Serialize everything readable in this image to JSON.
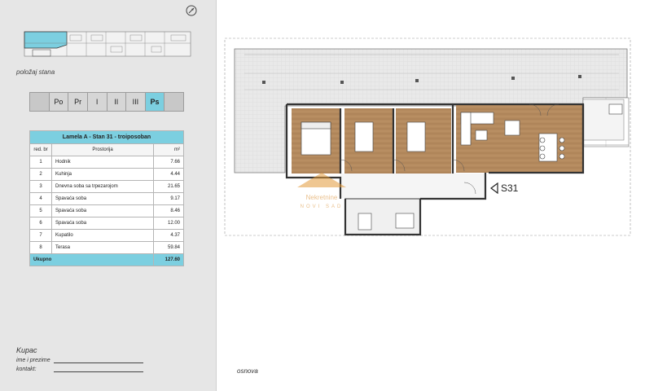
{
  "sidebar": {
    "position_label": "položaj stana",
    "floor_tabs": [
      {
        "label": "Po",
        "active": false
      },
      {
        "label": "Pr",
        "active": false
      },
      {
        "label": "I",
        "active": false
      },
      {
        "label": "II",
        "active": false
      },
      {
        "label": "III",
        "active": false
      },
      {
        "label": "Ps",
        "active": true
      }
    ],
    "table": {
      "title": "Lamela A - Stan 31 - troiposoban",
      "headers": {
        "number": "red. br",
        "room": "Prostorija",
        "area": "m²"
      },
      "rows": [
        {
          "nr": "1",
          "name": "Hodnik",
          "area": "7.66"
        },
        {
          "nr": "2",
          "name": "Kuhinja",
          "area": "4.44"
        },
        {
          "nr": "3",
          "name": "Dnevna soba sa trpezarojom",
          "area": "21.65"
        },
        {
          "nr": "4",
          "name": "Spavaća soba",
          "area": "9.17"
        },
        {
          "nr": "5",
          "name": "Spavaća soba",
          "area": "8.46"
        },
        {
          "nr": "6",
          "name": "Spavaća soba",
          "area": "12.00"
        },
        {
          "nr": "7",
          "name": "Kupatilo",
          "area": "4.37"
        },
        {
          "nr": "8",
          "name": "Terasa",
          "area": "59.84"
        }
      ],
      "total_label": "Ukupno",
      "total_value": "127.60"
    },
    "buyer": {
      "title": "Kupac",
      "name_label": "ime i prezime",
      "contact_label": "kontakt:"
    }
  },
  "plan": {
    "apartment_code": "S31",
    "caption": "osnova",
    "watermark_text": "Nekretnine",
    "watermark_sub": "NOVI SAD"
  },
  "colors": {
    "accent": "#7ccfe0",
    "panel": "#e6e6e6",
    "wood": "#b48a5e",
    "terrace": "#e9e9e9"
  }
}
